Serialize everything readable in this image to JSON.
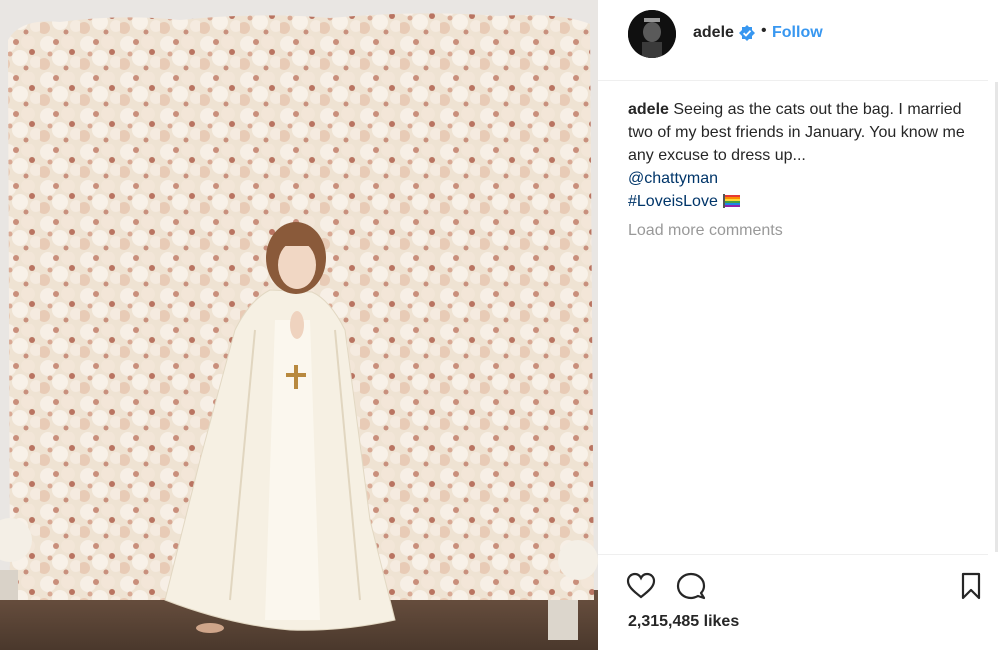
{
  "post": {
    "username": "adele",
    "follow_label": "Follow",
    "dot": "•",
    "verified": true,
    "caption": {
      "username": "adele",
      "text": "Seeing as the cats out the bag. I married two of my best friends in January. You know me any excuse to dress up...",
      "mention": "@chattyman",
      "hashtag": "#LoveisLove"
    },
    "load_more": "Load more comments",
    "likes": "2,315,485 likes"
  },
  "colors": {
    "accent": "#3897f0",
    "link": "#003569",
    "muted": "#999999",
    "text": "#262626"
  },
  "icons": {
    "like": "heart-icon",
    "comment": "comment-icon",
    "save": "bookmark-icon",
    "verified": "verified-badge-icon",
    "flag": "rainbow-flag-icon"
  }
}
